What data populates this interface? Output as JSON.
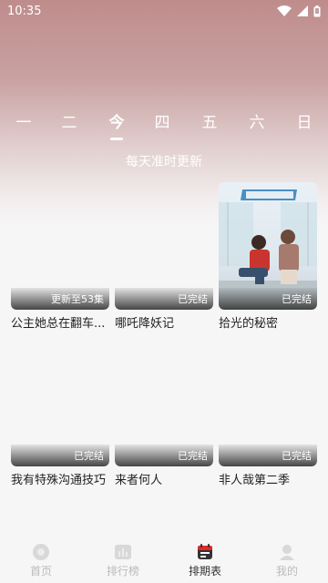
{
  "status_bar": {
    "time": "10:35"
  },
  "days": [
    {
      "label": "一",
      "active": false
    },
    {
      "label": "二",
      "active": false
    },
    {
      "label": "今",
      "active": true
    },
    {
      "label": "四",
      "active": false
    },
    {
      "label": "五",
      "active": false
    },
    {
      "label": "六",
      "active": false
    },
    {
      "label": "日",
      "active": false
    }
  ],
  "subtitle": "每天准时更新",
  "shows": [
    {
      "title": "公主她总在翻车...",
      "status": "更新至53集"
    },
    {
      "title": "哪吒降妖记",
      "status": "已完结"
    },
    {
      "title": "拾光的秘密",
      "status": "已完结"
    },
    {
      "title": "我有特殊沟通技巧",
      "status": "已完结"
    },
    {
      "title": "来者何人",
      "status": "已完结"
    },
    {
      "title": "非人哉第二季",
      "status": "已完结"
    }
  ],
  "bottom_nav": [
    {
      "label": "首页",
      "icon": "home-icon",
      "active": false
    },
    {
      "label": "排行榜",
      "icon": "ranking-icon",
      "active": false
    },
    {
      "label": "排期表",
      "icon": "calendar-icon",
      "active": true
    },
    {
      "label": "我的",
      "icon": "profile-icon",
      "active": false
    }
  ],
  "colors": {
    "accent_red": "#e02a2a",
    "active_text": "#333333",
    "inactive_text": "#bbbbbb"
  }
}
